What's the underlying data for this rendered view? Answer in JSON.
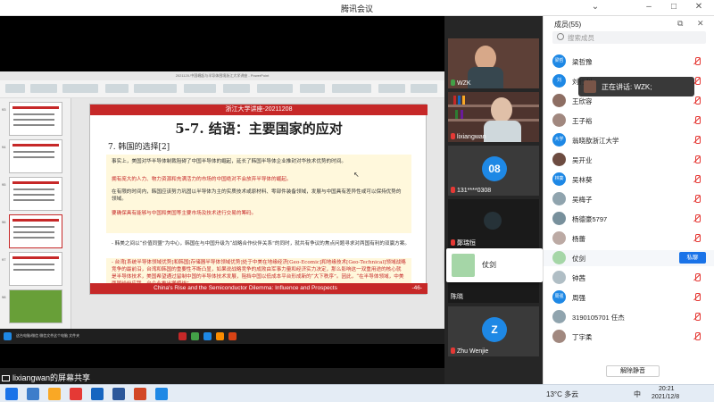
{
  "window": {
    "title": "腾讯会议"
  },
  "share": {
    "ppt_title": "2021120-中国崛起与半导体困境浙江大学讲座 - PowerPoint",
    "slide": {
      "header": "浙江大学讲座-20211208",
      "title": "5-7. 结语：主要国家的应对",
      "subtitle": "7. 韩国的选择[2]",
      "bullets": [
        {
          "text": "事实上，美国对华半导体制裁阻碍了中国半导体的崛起，延长了韩国半导体企业推封对华技术优势的时间。",
          "red": false
        },
        {
          "text": "拥有庞大的人力、物力资源和充满活力的市场的中国绝对不会放弃半导体的崛起。",
          "red": true
        },
        {
          "text": "在有限的时间内，韩国应该努力巩固以半导体为主的实质技术或原材料、零部件装备领域，发展与中国具有差异性或可以保持优势的领域。",
          "red": false
        },
        {
          "text": "要确保具有能够与中国和美国等主要市场及技术进行交易的筹码。",
          "red": true
        }
      ],
      "paragraph": "- 韩美之间以“价值同盟”为中心，韩国在与中国升级为“战略合作伙伴关系”的同时，就共有争议的焦点问题寻求对两国有利的双赢方案。",
      "paragraph2": "- 台湾[系统半导体领域优势]和韩国[存储器半导体领域优势]处于中美在地缘经济[Geo-Ecomic]和地缘技术[Geo-Technical]领域战略竞争的最前沿，台湾和韩国的重要性不断凸显，如果说战略竞争的成败由军事力量和经济实力决定，那么影响这一双重用途的核心就是半导体技术，美国希望通过留制中国的半导体技术发展，阻挡中国以低成本平台形成新的“大下秩序”。因此，“在半导体领域，中美两国纷纷应我，台企业推出搬模线”。",
      "footer": "China's Rise and the Semiconductor Dilemma: Influence and Prospects",
      "page_number": "-46-"
    },
    "thumb_numbers": [
      "93",
      "94",
      "95",
      "96",
      "97",
      "98"
    ],
    "taskbar_items": [
      "这台电脑/微信 微信文件",
      "这个电脑 文件夹"
    ],
    "sharer_label": "lixiangwan的屏幕共享"
  },
  "videos": [
    {
      "name": "WZK",
      "type": "camera"
    },
    {
      "name": "lixiangwan",
      "type": "camera"
    },
    {
      "name": "131****0308",
      "type": "avatar",
      "avatar_text": "08"
    },
    {
      "name": "鄭瑞恒",
      "type": "camera-dark"
    },
    {
      "name": "陈晓",
      "type": "camera-dark"
    },
    {
      "name": "Zhu Wenjie",
      "type": "avatar",
      "avatar_text": "Z"
    }
  ],
  "dialog": {
    "name": "仗剑"
  },
  "speaking": {
    "text": "正在讲话: WZK;"
  },
  "panel": {
    "title": "成员(55)",
    "search_placeholder": "搜索成员",
    "members": [
      {
        "name": "梁哲豫",
        "avatar": "梁哲",
        "color": "#1e88e5",
        "muted": true
      },
      {
        "name": "刘行利",
        "avatar": "刘",
        "color": "#1e88e5",
        "muted": true
      },
      {
        "name": "王欣容",
        "avatar": "",
        "color": "#8d6e63",
        "muted": true
      },
      {
        "name": "王子裕",
        "avatar": "",
        "color": "#a1887f",
        "muted": true
      },
      {
        "name": "翁晓歆浙江大学",
        "avatar": "大学",
        "color": "#1e88e5",
        "muted": true
      },
      {
        "name": "吴开业",
        "avatar": "",
        "color": "#6d4c41",
        "muted": true
      },
      {
        "name": "吴林葵",
        "avatar": "林葵",
        "color": "#1e88e5",
        "muted": true
      },
      {
        "name": "吴梅子",
        "avatar": "",
        "color": "#90a4ae",
        "muted": true
      },
      {
        "name": "杨德豪5797",
        "avatar": "",
        "color": "#78909c",
        "muted": true
      },
      {
        "name": "杨蕾",
        "avatar": "",
        "color": "#bcaaa4",
        "muted": true
      },
      {
        "name": "仗剑",
        "avatar": "",
        "color": "#a5d6a7",
        "muted": false,
        "private_label": "私聊"
      },
      {
        "name": "钟茜",
        "avatar": "",
        "color": "#b0bec5",
        "muted": true
      },
      {
        "name": "周强",
        "avatar": "周强",
        "color": "#1e88e5",
        "muted": true
      },
      {
        "name": "3190105701 任杰",
        "avatar": "",
        "color": "#90a4ae",
        "muted": true
      },
      {
        "name": "丁宇柔",
        "avatar": "",
        "color": "#a1887f",
        "muted": true
      }
    ],
    "unmute_all": "解除静音"
  },
  "taskbar": {
    "weather": "13°C 多云",
    "time": "20:21",
    "date": "2021/12/8",
    "ime": "中"
  }
}
